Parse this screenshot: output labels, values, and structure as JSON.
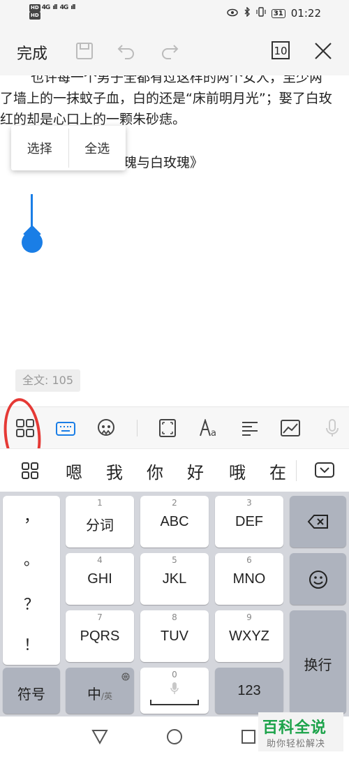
{
  "status_bar": {
    "hd_1": "HD",
    "hd_2": "HD",
    "signal_1": "4G",
    "signal_2": "4G",
    "battery": "31",
    "time": "01:22"
  },
  "toolbar": {
    "done_label": "完成",
    "page_count": "10"
  },
  "document": {
    "lines": [
      "也许每一个男子全都有过这样的两个女人，至少两",
      "了墙上的一抹蚊子血，白的还是“床前明月光”；娶了白玫",
      "红的却是心口上的一颗朱砂痣。",
      "《红玫瑰与白玫瑰》"
    ],
    "popup": {
      "select_label": "选择",
      "select_all_label": "全选"
    },
    "word_count": "全文: 105"
  },
  "ime": {
    "candidates": [
      "嗯",
      "我",
      "你",
      "好",
      "哦",
      "在"
    ],
    "punctuation": [
      "，",
      "。",
      "？",
      "！"
    ],
    "keys": {
      "k1": {
        "num": "1",
        "label": "分词"
      },
      "k2": {
        "num": "2",
        "label": "ABC"
      },
      "k3": {
        "num": "3",
        "label": "DEF"
      },
      "k4": {
        "num": "4",
        "label": "GHI"
      },
      "k5": {
        "num": "5",
        "label": "JKL"
      },
      "k6": {
        "num": "6",
        "label": "MNO"
      },
      "k7": {
        "num": "7",
        "label": "PQRS"
      },
      "k8": {
        "num": "8",
        "label": "TUV"
      },
      "k9": {
        "num": "9",
        "label": "WXYZ"
      },
      "k0": {
        "num": "0"
      }
    },
    "symbols_label": "符号",
    "lang_label": "中",
    "lang_sub": "/英",
    "num_label": "123",
    "enter_label": "换行"
  },
  "watermark": {
    "title": "百科全说",
    "subtitle": "助你轻松解决"
  },
  "colors": {
    "accent": "#1a7ee6",
    "annotation": "#e53935",
    "watermark": "#1ca34a"
  }
}
